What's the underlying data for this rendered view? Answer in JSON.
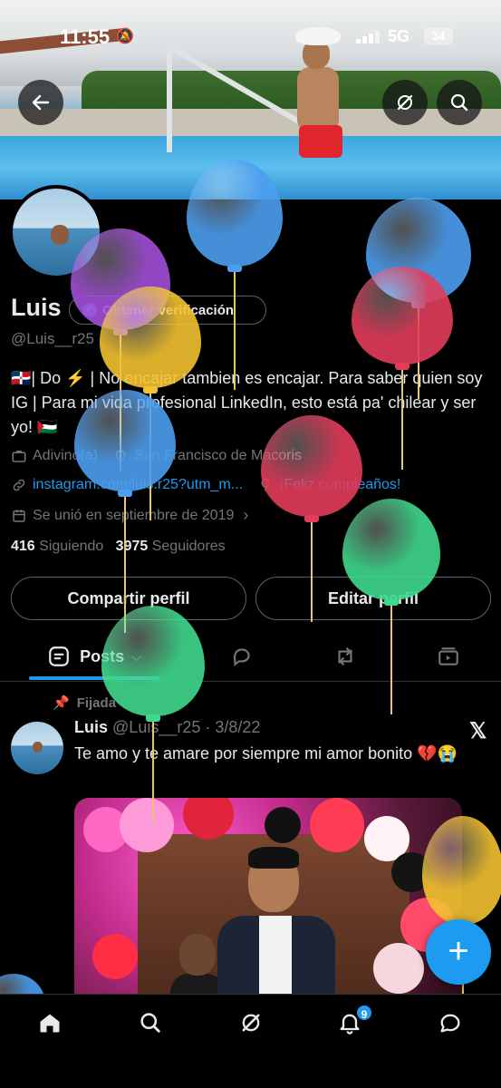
{
  "status_bar": {
    "time": "11:55",
    "network": "5G",
    "battery": "34"
  },
  "header": {
    "back_icon": "arrow-left-icon",
    "grok_icon": "grok-icon",
    "search_icon": "search-icon"
  },
  "profile": {
    "name": "Luis",
    "verify_label": "Obtener verificación",
    "handle": "@Luis__r25",
    "bio": "🇩🇴| Do ⚡️ | No encajar tambien es encajar. Para saber quien soy IG | Para mi vida profesional LinkedIn, esto está pa' chilear y ser yo! 🇵🇸",
    "job": "Adivino(a)",
    "location": "San Francisco de Macoris",
    "link": "instagram.com/luis.r25?utm_m...",
    "birthday": "¡Feliz cumpleaños!",
    "joined": "Se unió en septiembre de 2019",
    "following_count": "416",
    "following_label": "Siguiendo",
    "followers_count": "3975",
    "followers_label": "Seguidores",
    "share_button": "Compartir perfil",
    "edit_button": "Editar perfil"
  },
  "tabs": {
    "posts": "Posts"
  },
  "post": {
    "pinned_label": "Fijada",
    "author": "Luis",
    "handle": "@Luis__r25",
    "date": "· 3/8/22",
    "text": "Te amo y te amare por siempre mi amor bonito 💔😭"
  },
  "fab_label": "+",
  "bottom_nav": {
    "notifications_badge": "9"
  },
  "colors": {
    "accent": "#1d9bf0",
    "background": "#000000",
    "muted": "#71767b"
  },
  "balloons": [
    {
      "color": "#4d9ef0"
    },
    {
      "color": "#a24fd8"
    },
    {
      "color": "#4d9ef0"
    },
    {
      "color": "#e23c5a"
    },
    {
      "color": "#f2c230"
    },
    {
      "color": "#4d9ef0"
    },
    {
      "color": "#e23c5a"
    },
    {
      "color": "#3fd98c"
    },
    {
      "color": "#3fd98c"
    },
    {
      "color": "#f2c230"
    },
    {
      "color": "#4d9ef0"
    }
  ]
}
